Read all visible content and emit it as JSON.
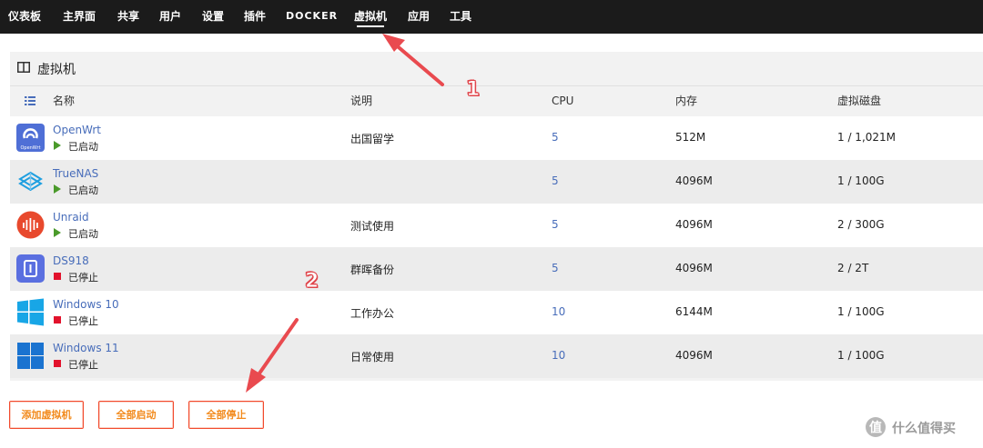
{
  "nav": {
    "items": [
      "仪表板",
      "主界面",
      "共享",
      "用户",
      "设置",
      "插件",
      "DOCKER",
      "虚拟机",
      "应用",
      "工具"
    ],
    "active": "虚拟机"
  },
  "panel": {
    "title": "虚拟机",
    "columns": {
      "name": "名称",
      "desc": "说明",
      "cpu": "CPU",
      "memory": "内存",
      "vdisk": "虚拟磁盘"
    }
  },
  "vms": [
    {
      "name": "OpenWrt",
      "state": "已启动",
      "running": true,
      "desc": "出国留学",
      "cpu": "5",
      "memory": "512M",
      "vdisk": "1 / 1,021M",
      "icon": "openwrt-logo-icon",
      "icon_sub": "OpenWrt"
    },
    {
      "name": "TrueNAS",
      "state": "已启动",
      "running": true,
      "desc": "",
      "cpu": "5",
      "memory": "4096M",
      "vdisk": "1 / 100G",
      "icon": "truenas-logo-icon"
    },
    {
      "name": "Unraid",
      "state": "已启动",
      "running": true,
      "desc": "测试使用",
      "cpu": "5",
      "memory": "4096M",
      "vdisk": "2 / 300G",
      "icon": "unraid-logo-icon"
    },
    {
      "name": "DS918",
      "state": "已停止",
      "running": false,
      "desc": "群晖备份",
      "cpu": "5",
      "memory": "4096M",
      "vdisk": "2 / 2T",
      "icon": "synology-logo-icon"
    },
    {
      "name": "Windows 10",
      "state": "已停止",
      "running": false,
      "desc": "工作办公",
      "cpu": "10",
      "memory": "6144M",
      "vdisk": "1 / 100G",
      "icon": "windows10-logo-icon"
    },
    {
      "name": "Windows 11",
      "state": "已停止",
      "running": false,
      "desc": "日常使用",
      "cpu": "10",
      "memory": "4096M",
      "vdisk": "1 / 100G",
      "icon": "windows11-logo-icon"
    }
  ],
  "buttons": {
    "add": "添加虚拟机",
    "start_all": "全部启动",
    "stop_all": "全部停止"
  },
  "annotations": {
    "n1": "1",
    "n2": "2",
    "arrow_color": "#e94a4f"
  },
  "watermark": {
    "text": "什么值得买",
    "icon": "smzdm-logo-icon"
  },
  "colors": {
    "accent_link": "#486dba",
    "running": "#4a9a2b",
    "stopped": "#e2122c",
    "button_border": "#f24a2d",
    "button_text": "#f28a1c"
  }
}
